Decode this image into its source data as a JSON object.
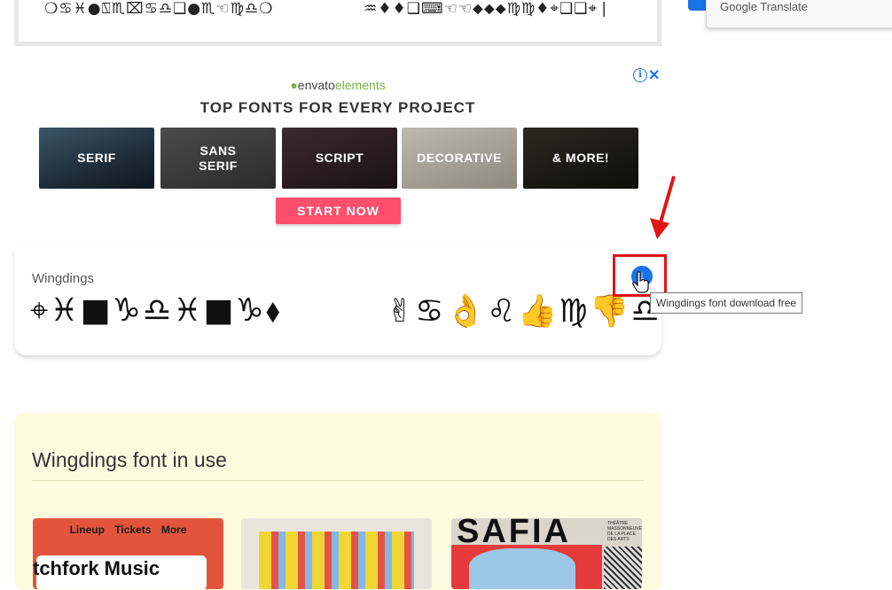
{
  "top_preview": {
    "glyphs_left": "❍♋♓●⍂♏⌧♋♎❑●♏☜♍♎❍",
    "glyphs_right": "♒♦♦❑⌨☜☜⬥⬥⬥♍♍♦⌖❑❑⌖❘"
  },
  "google_translate": {
    "label": "Google Translate"
  },
  "ad": {
    "brand": "envatoelements",
    "brand_leaf": "●",
    "brand_text_a": "envato",
    "brand_text_b": "elements",
    "info_icon": "i",
    "close_icon": "✕",
    "headline": "TOP FONTS FOR EVERY PROJECT",
    "tiles": [
      "SERIF",
      "SANS SERIF",
      "SCRIPT",
      "DECORATIVE",
      "& MORE!"
    ],
    "tile2_line1": "SANS",
    "tile2_line2": "SERIF",
    "cta": "START NOW"
  },
  "font_card": {
    "name": "Wingdings",
    "sample_a": "⌖♓■♑♎♓■♑⬧",
    "sample_b": "✌♋👌♌👍♍👎♎",
    "download_icon": "↓",
    "tooltip": "Wingdings font download free",
    "cursor_icon": "hand-pointer"
  },
  "in_use": {
    "title": "Wingdings font in use",
    "thumb1_nav": "Lineup Tickets More",
    "thumb1_text": "tchfork Music",
    "thumb3_text": "SAFIA",
    "thumb3_small": "THÉÂTRE MASSONNEUVE DE LA PLACE DES ARTS"
  }
}
